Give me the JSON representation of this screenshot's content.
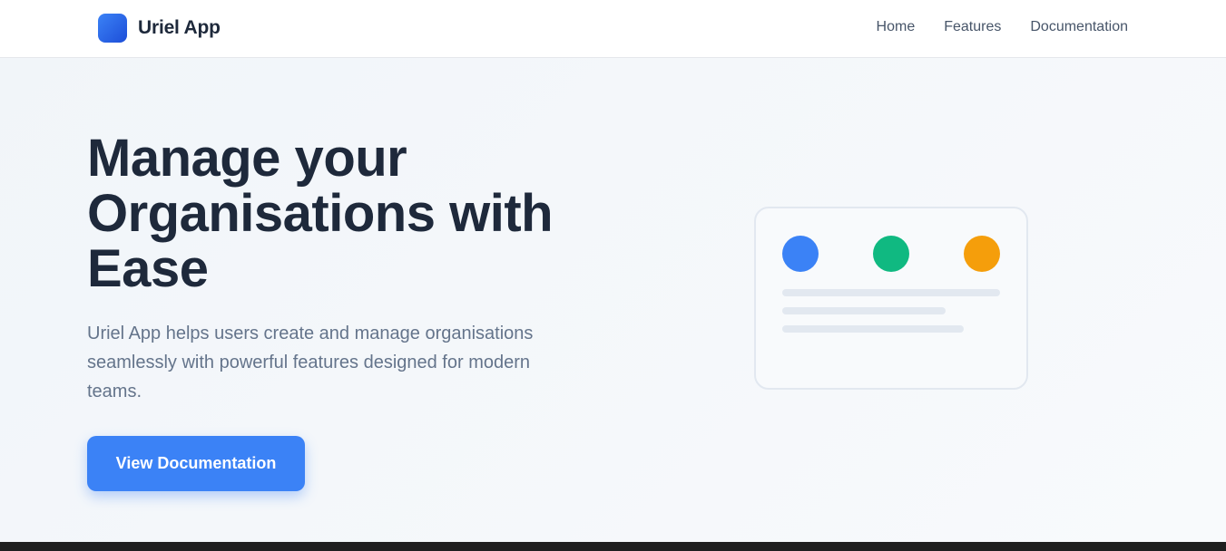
{
  "header": {
    "brand_name": "Uriel App",
    "nav": [
      {
        "label": "Home"
      },
      {
        "label": "Features"
      },
      {
        "label": "Documentation"
      }
    ]
  },
  "hero": {
    "title": "Manage your Organisations with Ease",
    "description": "Uriel App helps users create and manage organisations seamlessly with powerful features designed for modern teams.",
    "cta_label": "View Documentation"
  },
  "preview": {
    "dot_colors": [
      "#3b82f6",
      "#10b981",
      "#f59e0b"
    ]
  },
  "colors": {
    "accent": "#3b82f6",
    "heading": "#1e293b",
    "body_text": "#64748b"
  }
}
